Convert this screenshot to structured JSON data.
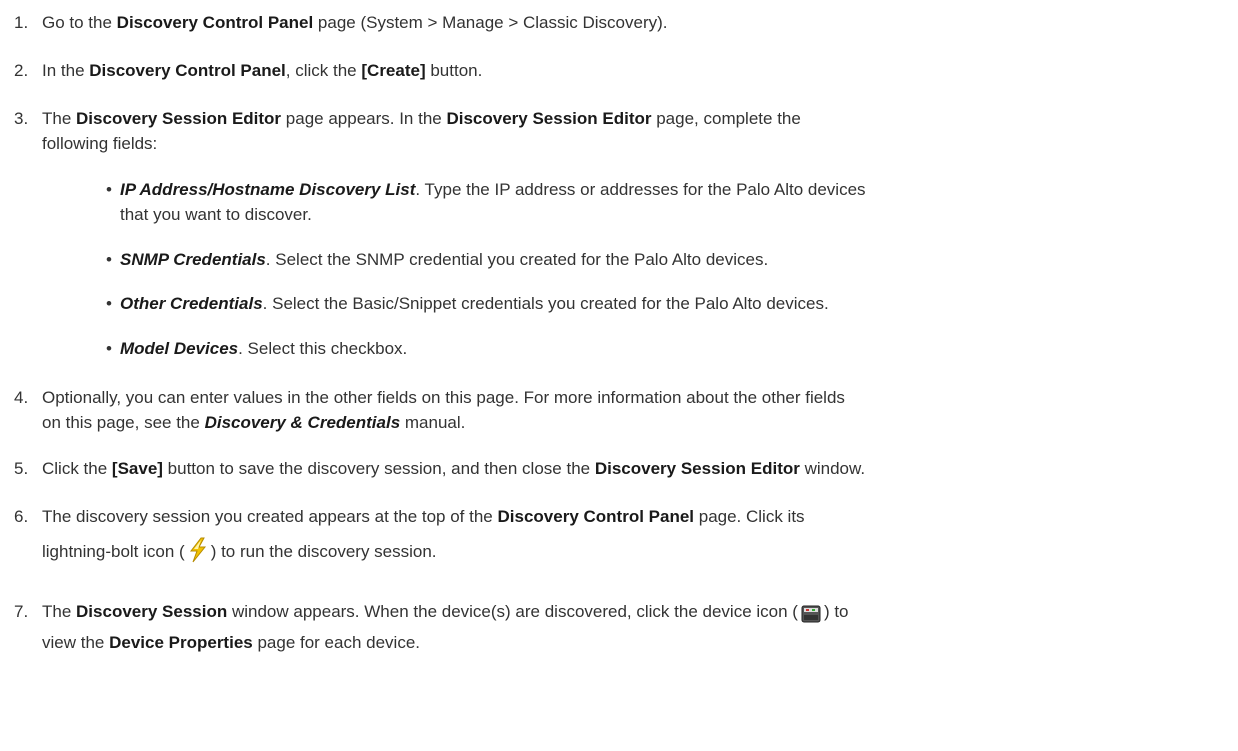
{
  "steps": [
    {
      "n": "1.",
      "a": "Go to the ",
      "b1": "Discovery Control Panel",
      "c": " page (System > Manage > Classic Discovery)."
    },
    {
      "n": "2.",
      "a": "In the ",
      "b1": "Discovery Control Panel",
      "c": ", click the ",
      "b2": "[Create]",
      "d": " button."
    },
    {
      "n": "3.",
      "a": "The ",
      "b1": "Discovery Session Editor",
      "c": " page appears. In the ",
      "b2": "Discovery Session Editor",
      "d": " page, complete the",
      "e": "following fields:"
    },
    {
      "n": "4.",
      "a": "Optionally, you can enter values in the other fields on this page. For more information about the other fields",
      "e": "on this page, see the ",
      "b2": "Discovery & Credentials",
      "d": " manual."
    },
    {
      "n": "5.",
      "a": "Click the ",
      "b1": "[Save]",
      "c": " button to save the discovery session, and then close the ",
      "b2": "Discovery Session Editor",
      "d": " window."
    },
    {
      "n": "6.",
      "a": "The discovery session you created appears at the top of the ",
      "b1": "Discovery Control Panel",
      "c": " page. Click its",
      "e": "lightning-bolt icon (",
      "f": ") to run the discovery session."
    },
    {
      "n": "7.",
      "a": "The ",
      "b1": "Discovery Session",
      "c": " window appears. When the device(s) are discovered, click the device icon (",
      "d": ") to",
      "e": "view the ",
      "b2": "Device Properties",
      "g": " page for each device."
    }
  ],
  "bullets": [
    {
      "dot": "•",
      "field": "IP Address/Hostname Discovery List",
      "text": ". Type the IP address or addresses for the Palo Alto devices",
      "text2": "that you want to discover."
    },
    {
      "dot": "•",
      "field": "SNMP Credentials",
      "text": ". Select the SNMP credential you created for the Palo Alto devices."
    },
    {
      "dot": "•",
      "field": "Other Credentials",
      "text": ". Select the Basic/Snippet credentials you created for the Palo Alto devices."
    },
    {
      "dot": "•",
      "field": "Model Devices",
      "text": ". Select this checkbox."
    }
  ],
  "icons": {
    "step6": "lightning-bolt-icon",
    "step7": "device-icon"
  },
  "colors": {
    "text": "#333333",
    "bold": "#1a1a1a",
    "bolt": "#f2c200"
  }
}
